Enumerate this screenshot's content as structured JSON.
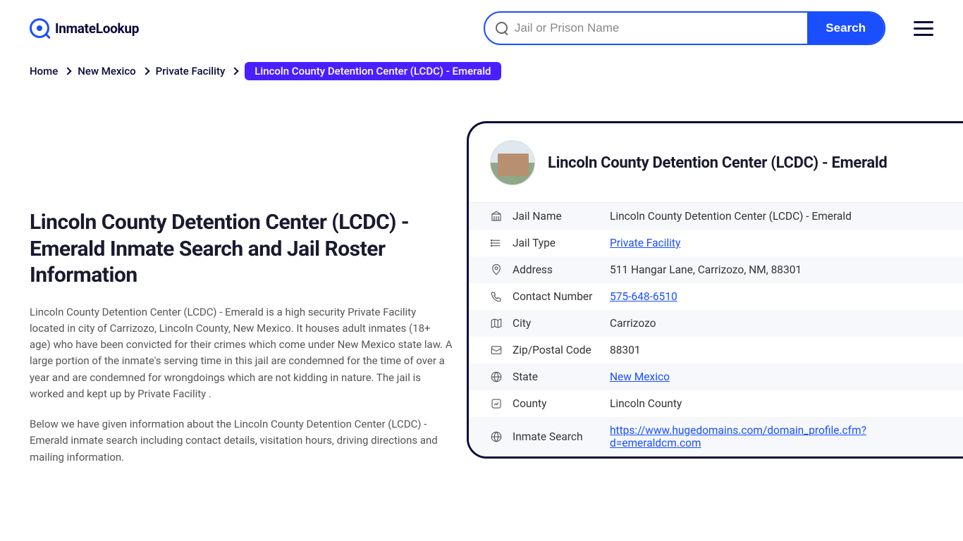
{
  "logo": {
    "text": "InmateLookup"
  },
  "search": {
    "placeholder": "Jail or Prison Name",
    "button": "Search"
  },
  "breadcrumb": {
    "items": [
      "Home",
      "New Mexico",
      "Private Facility"
    ],
    "current": "Lincoln County Detention Center (LCDC) - Emerald"
  },
  "main": {
    "heading": "Lincoln County Detention Center (LCDC) - Emerald Inmate Search and Jail Roster Information",
    "p1": "Lincoln County Detention Center (LCDC) - Emerald is a high security Private Facility located in city of Carrizozo, Lincoln County, New Mexico. It houses adult inmates (18+ age) who have been convicted for their crimes which come under New Mexico state law. A large portion of the inmate's serving time in this jail are condemned for the time of over a year and are condemned for wrongdoings which are not kidding in nature. The jail is worked and kept up by Private Facility .",
    "p2": "Below we have given information about the Lincoln County Detention Center (LCDC) - Emerald inmate search including contact details, visitation hours, driving directions and mailing information."
  },
  "card": {
    "title": "Lincoln County Detention Center (LCDC) - Emerald",
    "rows": [
      {
        "label": "Jail Name",
        "value": "Lincoln County Detention Center (LCDC) - Emerald",
        "link": false
      },
      {
        "label": "Jail Type",
        "value": "Private Facility",
        "link": true
      },
      {
        "label": "Address",
        "value": "511 Hangar Lane, Carrizozo, NM, 88301",
        "link": false
      },
      {
        "label": "Contact Number",
        "value": "575-648-6510",
        "link": true
      },
      {
        "label": "City",
        "value": "Carrizozo",
        "link": false
      },
      {
        "label": "Zip/Postal Code",
        "value": "88301",
        "link": false
      },
      {
        "label": "State",
        "value": "New Mexico",
        "link": true
      },
      {
        "label": "County",
        "value": "Lincoln County",
        "link": false
      },
      {
        "label": "Inmate Search",
        "value": "https://www.hugedomains.com/domain_profile.cfm?d=emeraldcm.com",
        "link": true
      }
    ]
  }
}
